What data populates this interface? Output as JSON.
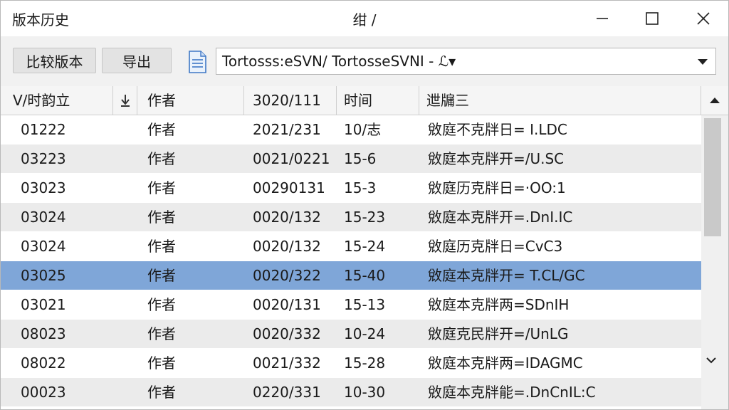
{
  "window": {
    "app_title": "版本历史",
    "center_title": "绀 /"
  },
  "toolbar": {
    "compare_label": "比较版本",
    "export_label": "导出",
    "path_value": "Tortosss:eSVN/ TortosseSVNI - ℒ▾"
  },
  "table": {
    "headers": {
      "revision": "V/时韵立",
      "author": "作者",
      "date": "3020/111",
      "time": "时间",
      "message": "迣牖三"
    },
    "rows": [
      {
        "revision": "01222",
        "author": "作者",
        "date": "2021/231",
        "time": "10/志",
        "message": "敓庭不克牉日= I.LDC"
      },
      {
        "revision": "03223",
        "author": "作者",
        "date": "0021/0221",
        "time": "15-6",
        "message": "敓庭本克牉开=/U.SC"
      },
      {
        "revision": "03023",
        "author": "作者",
        "date": "00290131",
        "time": "15-3",
        "message": "敓庭历克牉日=·OO:1"
      },
      {
        "revision": "03024",
        "author": "作者",
        "date": "0020/132",
        "time": "15-23",
        "message": "敓庭本克牉开=.DnI.IC"
      },
      {
        "revision": "03024",
        "author": "作者",
        "date": "0020/132",
        "time": "15-24",
        "message": "敓庭历克牉日=CvC3"
      },
      {
        "revision": "03025",
        "author": "作者",
        "date": "0020/322",
        "time": "15-40",
        "message": "敓庭本克牉开= T.CL/GC"
      },
      {
        "revision": "03021",
        "author": "作者",
        "date": "0020/131",
        "time": "15-13",
        "message": "敓庭本克牉两=SDnIH"
      },
      {
        "revision": "08023",
        "author": "作者",
        "date": "0020/332",
        "time": "10-24",
        "message": "敓庭克民牉开=/UnLG"
      },
      {
        "revision": "08022",
        "author": "作者",
        "date": "0021/332",
        "time": "15-28",
        "message": "敓庭本克牉两=IDAGMC"
      },
      {
        "revision": "00023",
        "author": "作者",
        "date": "0220/331",
        "time": "10-30",
        "message": "敓庭本克牉能=.DnCnIL:C"
      }
    ],
    "selected_row": 5
  },
  "colors": {
    "selected_row": "#7fa6d8",
    "alt_row": "#ebebeb",
    "toolbar_bg": "#f1f1f1"
  },
  "icons": {
    "minimize": "minimize-icon",
    "maximize": "maximize-icon",
    "close": "close-icon",
    "sort": "sort-down-icon",
    "document": "document-icon",
    "dropdown": "chevron-down-icon"
  }
}
